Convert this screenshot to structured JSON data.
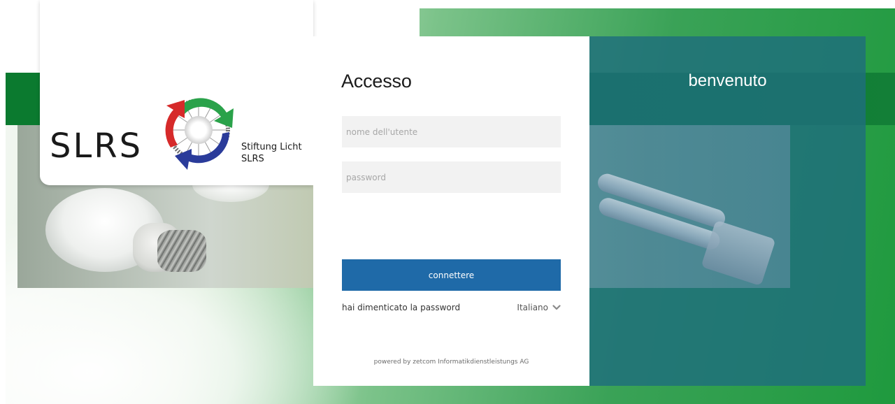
{
  "logo": {
    "wordmark": "SLRS",
    "subtitle_line1": "Stiftung Licht",
    "subtitle_line2": "SLRS",
    "emblem_icon": "recycle-arrows-icon",
    "colors": {
      "green": "#2aa24a",
      "blue": "#2a3b9a",
      "red": "#d62a2a"
    }
  },
  "login": {
    "title": "Accesso",
    "username_placeholder": "nome dell'utente",
    "password_placeholder": "password",
    "submit_label": "connettere",
    "forgot_password": "hai dimenticato la password",
    "language": "Italiano",
    "language_icon": "chevron-down-icon",
    "powered_by": "powered by zetcom Informatikdienstleistungs AG"
  },
  "welcome": {
    "title": "benvenuto"
  },
  "theme": {
    "accent": "#1f6aa8",
    "band_green": "#0b7a2f",
    "welcome_teal": "#1e6e7d"
  }
}
